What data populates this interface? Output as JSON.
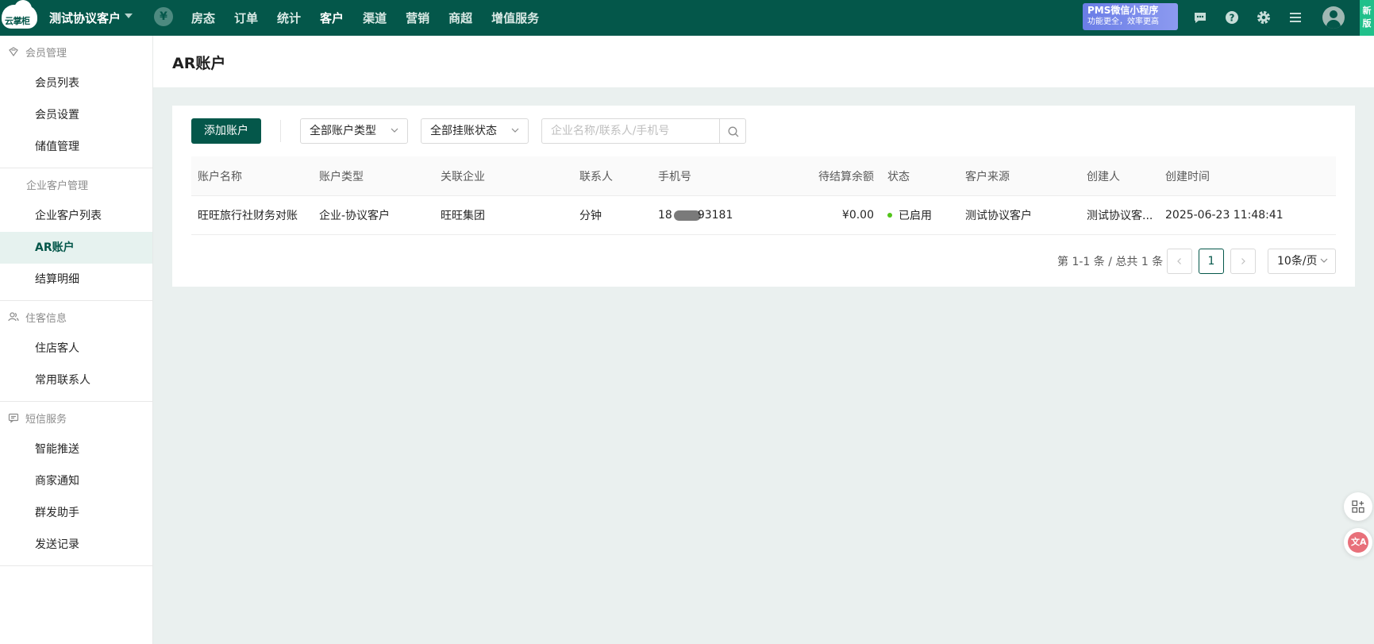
{
  "topbar": {
    "logo_text": "云掌柜",
    "hotel_name": "测试协议客户",
    "currency_symbol": "¥",
    "nav": [
      {
        "label": "房态",
        "active": false
      },
      {
        "label": "订单",
        "active": false
      },
      {
        "label": "统计",
        "active": false
      },
      {
        "label": "客户",
        "active": true
      },
      {
        "label": "渠道",
        "active": false
      },
      {
        "label": "营销",
        "active": false
      },
      {
        "label": "商超",
        "active": false
      },
      {
        "label": "增值服务",
        "active": false
      }
    ],
    "promo_line1": "PMS微信小程序",
    "promo_line2": "功能更全，效率更高",
    "new_tab_label": "新版",
    "icons": [
      "message-icon",
      "help-icon",
      "settings-icon",
      "menu-icon",
      "user-avatar-icon"
    ]
  },
  "sidebar": {
    "groups": [
      {
        "title": "会员管理",
        "icon": "member-icon",
        "items": [
          {
            "label": "会员列表",
            "active": false
          },
          {
            "label": "会员设置",
            "active": false
          },
          {
            "label": "储值管理",
            "active": false
          }
        ]
      },
      {
        "title": "企业客户管理",
        "icon": "",
        "items": [
          {
            "label": "企业客户列表",
            "active": false
          },
          {
            "label": "AR账户",
            "active": true
          },
          {
            "label": "结算明细",
            "active": false
          }
        ]
      },
      {
        "title": "住客信息",
        "icon": "guest-icon",
        "items": [
          {
            "label": "住店客人",
            "active": false
          },
          {
            "label": "常用联系人",
            "active": false
          }
        ]
      },
      {
        "title": "短信服务",
        "icon": "sms-icon",
        "items": [
          {
            "label": "智能推送",
            "active": false
          },
          {
            "label": "商家通知",
            "active": false
          },
          {
            "label": "群发助手",
            "active": false
          },
          {
            "label": "发送记录",
            "active": false
          }
        ]
      }
    ]
  },
  "page": {
    "title": "AR账户"
  },
  "toolbar": {
    "add_label": "添加账户",
    "account_type_filter": "全部账户类型",
    "credit_status_filter": "全部挂账状态",
    "search_placeholder": "企业名称/联系人/手机号"
  },
  "table": {
    "columns": [
      "账户名称",
      "账户类型",
      "关联企业",
      "联系人",
      "手机号",
      "待结算余额",
      "状态",
      "客户来源",
      "创建人",
      "创建时间"
    ],
    "rows": [
      {
        "account_name": "旺旺旅行社财务对账",
        "account_type": "企业-协议客户",
        "company": "旺旺集团",
        "contact": "分钟",
        "phone_prefix": "18",
        "phone_suffix": "93181",
        "balance": "¥0.00",
        "status": "已启用",
        "status_color": "#52c41a",
        "source": "测试协议客户",
        "creator": "测试协议客...",
        "created_at": "2025-06-23 11:48:41"
      }
    ]
  },
  "pagination": {
    "summary": "第 1-1 条 / 总共 1 条",
    "current_page": "1",
    "page_size": "10条/页"
  },
  "colors": {
    "brand": "#04574a",
    "promo": "#7b8cea",
    "new_badge": "#20c08a"
  }
}
